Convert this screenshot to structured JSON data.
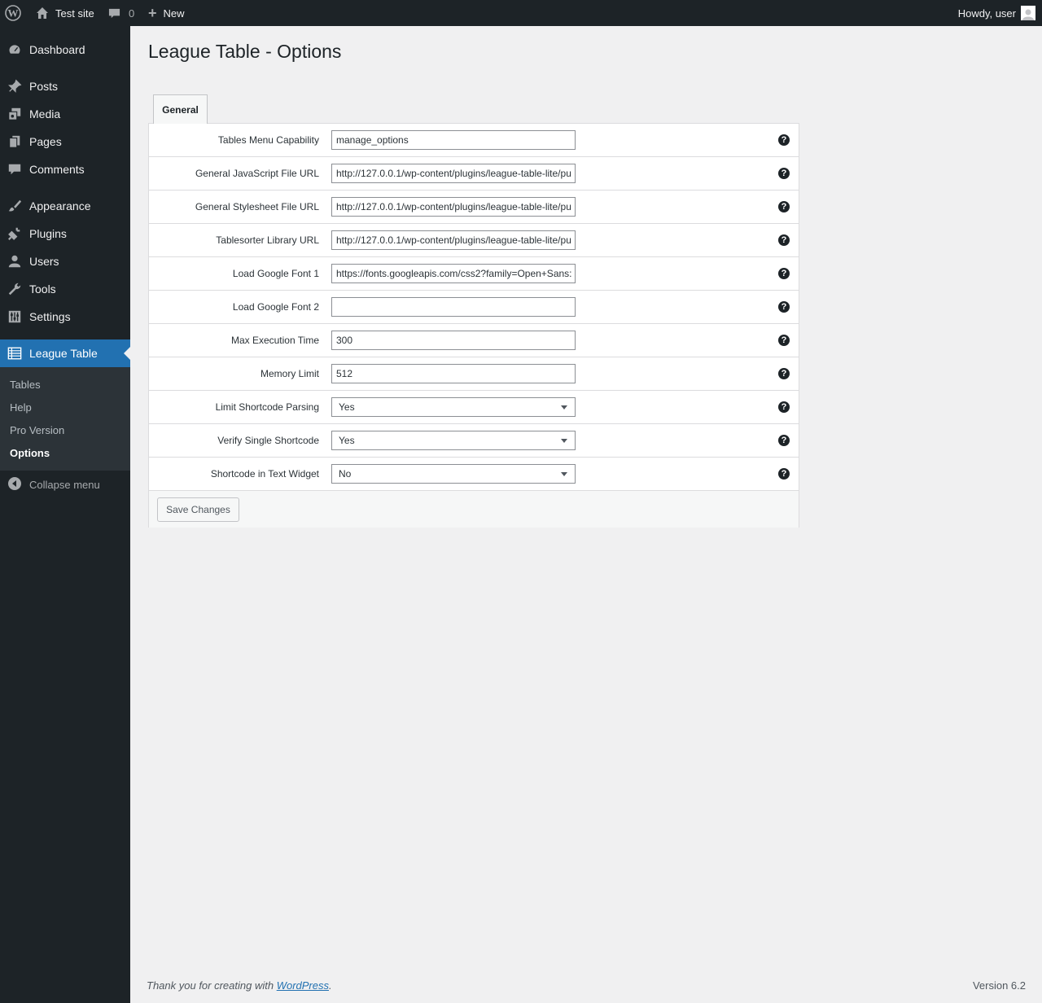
{
  "adminbar": {
    "site_name": "Test site",
    "comments_count": "0",
    "new_label": "New",
    "howdy": "Howdy, user"
  },
  "sidebar": {
    "items": [
      {
        "label": "Dashboard",
        "icon": "dashboard-icon"
      },
      {
        "label": "Posts",
        "icon": "pin-icon"
      },
      {
        "label": "Media",
        "icon": "media-icon"
      },
      {
        "label": "Pages",
        "icon": "pages-icon"
      },
      {
        "label": "Comments",
        "icon": "comment-icon"
      },
      {
        "label": "Appearance",
        "icon": "brush-icon"
      },
      {
        "label": "Plugins",
        "icon": "plug-icon"
      },
      {
        "label": "Users",
        "icon": "user-icon"
      },
      {
        "label": "Tools",
        "icon": "wrench-icon"
      },
      {
        "label": "Settings",
        "icon": "settings-icon"
      },
      {
        "label": "League Table",
        "icon": "table-icon"
      }
    ],
    "submenu": [
      "Tables",
      "Help",
      "Pro Version",
      "Options"
    ],
    "collapse_label": "Collapse menu"
  },
  "page": {
    "title": "League Table - Options",
    "tab": "General"
  },
  "options": [
    {
      "label": "Tables Menu Capability",
      "value": "manage_options",
      "type": "text"
    },
    {
      "label": "General JavaScript File URL",
      "value": "http://127.0.0.1/wp-content/plugins/league-table-lite/pu",
      "type": "text"
    },
    {
      "label": "General Stylesheet File URL",
      "value": "http://127.0.0.1/wp-content/plugins/league-table-lite/pu",
      "type": "text"
    },
    {
      "label": "Tablesorter Library URL",
      "value": "http://127.0.0.1/wp-content/plugins/league-table-lite/pu",
      "type": "text"
    },
    {
      "label": "Load Google Font 1",
      "value": "https://fonts.googleapis.com/css2?family=Open+Sans:",
      "type": "text"
    },
    {
      "label": "Load Google Font 2",
      "value": "",
      "type": "text"
    },
    {
      "label": "Max Execution Time",
      "value": "300",
      "type": "text"
    },
    {
      "label": "Memory Limit",
      "value": "512",
      "type": "text"
    },
    {
      "label": "Limit Shortcode Parsing",
      "value": "Yes",
      "type": "select"
    },
    {
      "label": "Verify Single Shortcode",
      "value": "Yes",
      "type": "select"
    },
    {
      "label": "Shortcode in Text Widget",
      "value": "No",
      "type": "select"
    }
  ],
  "help_glyph": "?",
  "save_label": "Save Changes",
  "footer": {
    "thanks_prefix": "Thank you for creating with ",
    "wp_link": "WordPress",
    "thanks_suffix": ".",
    "version": "Version 6.2"
  },
  "colors": {
    "adminbar_bg": "#1d2327",
    "menu_current": "#2271b1",
    "page_bg": "#f0f0f1"
  }
}
